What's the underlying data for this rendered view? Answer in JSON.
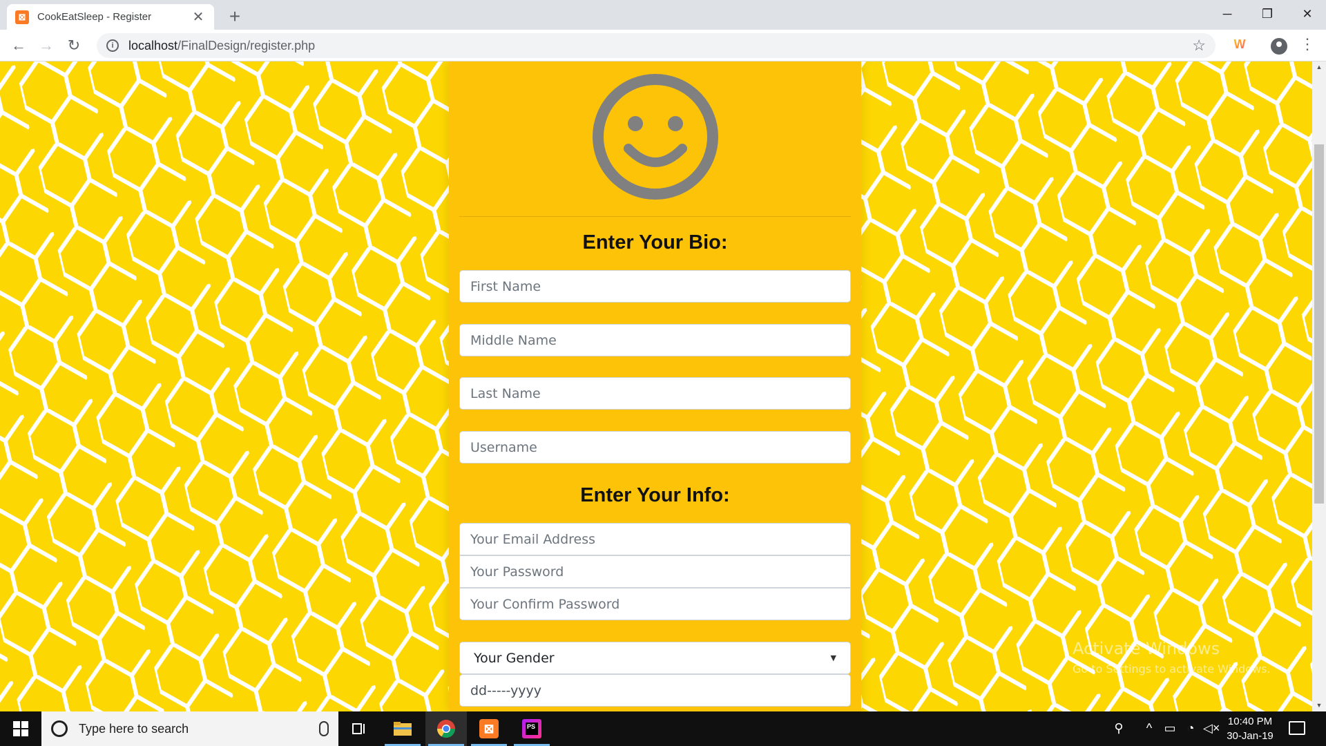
{
  "browser": {
    "tab_title": "CookEatSleep - Register",
    "url_host": "localhost",
    "url_path": "/FinalDesign/register.php",
    "new_tab_symbol": "+",
    "tab_close_symbol": "✕"
  },
  "page": {
    "bio_heading": "Enter Your Bio:",
    "info_heading": "Enter Your Info:",
    "fields": {
      "first_name_placeholder": "First Name",
      "middle_name_placeholder": "Middle Name",
      "last_name_placeholder": "Last Name",
      "username_placeholder": "Username",
      "email_placeholder": "Your Email Address",
      "password_placeholder": "Your Password",
      "confirm_password_placeholder": "Your Confirm Password",
      "gender_selected": "Your Gender",
      "date_value": "dd-----yyyy"
    },
    "colors": {
      "background": "#fcd702",
      "card": "#fdc309",
      "honeycomb_lines": "#ffffff",
      "avatar": "#808080"
    }
  },
  "watermark": {
    "line1": "Activate Windows",
    "line2": "Go to Settings to activate Windows."
  },
  "taskbar": {
    "search_placeholder": "Type here to search",
    "time": "10:40 PM",
    "date": "30-Jan-19",
    "apps": [
      "file-explorer",
      "chrome",
      "xampp",
      "phpstorm"
    ]
  }
}
